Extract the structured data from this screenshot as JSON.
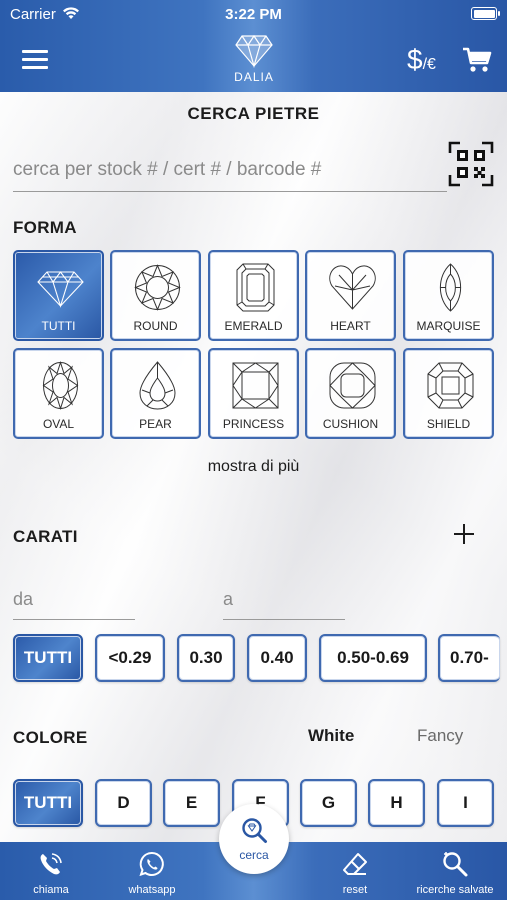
{
  "status_bar": {
    "carrier": "Carrier",
    "time": "3:22 PM"
  },
  "header": {
    "logo_text": "DALIA",
    "currency_symbol": "$",
    "currency_alt": "/€"
  },
  "search": {
    "title": "CERCA PIETRE",
    "placeholder": "cerca per stock # / cert # / barcode #"
  },
  "shape_section": {
    "label": "FORMA",
    "shapes": [
      {
        "label": "TUTTI",
        "selected": true
      },
      {
        "label": "ROUND"
      },
      {
        "label": "EMERALD"
      },
      {
        "label": "HEART"
      },
      {
        "label": "MARQUISE"
      },
      {
        "label": "OVAL"
      },
      {
        "label": "PEAR"
      },
      {
        "label": "PRINCESS"
      },
      {
        "label": "CUSHION"
      },
      {
        "label": "SHIELD"
      }
    ],
    "show_more": "mostra di più"
  },
  "carat_section": {
    "label": "CARATI",
    "from_placeholder": "da",
    "to_placeholder": "a",
    "chips": [
      "TUTTI",
      "<0.29",
      "0.30",
      "0.40",
      "0.50-0.69",
      "0.70-"
    ]
  },
  "color_section": {
    "label": "COLORE",
    "tab_white": "White",
    "tab_fancy": "Fancy",
    "chips": [
      "TUTTI",
      "D",
      "E",
      "F",
      "G",
      "H",
      "I"
    ]
  },
  "tabbar": {
    "call": "chiama",
    "whatsapp": "whatsapp",
    "search": "cerca",
    "reset": "reset",
    "saved": "ricerche salvate"
  },
  "colors": {
    "brand_blue": "#2a5cab",
    "accent_light": "#5c8fd2"
  }
}
